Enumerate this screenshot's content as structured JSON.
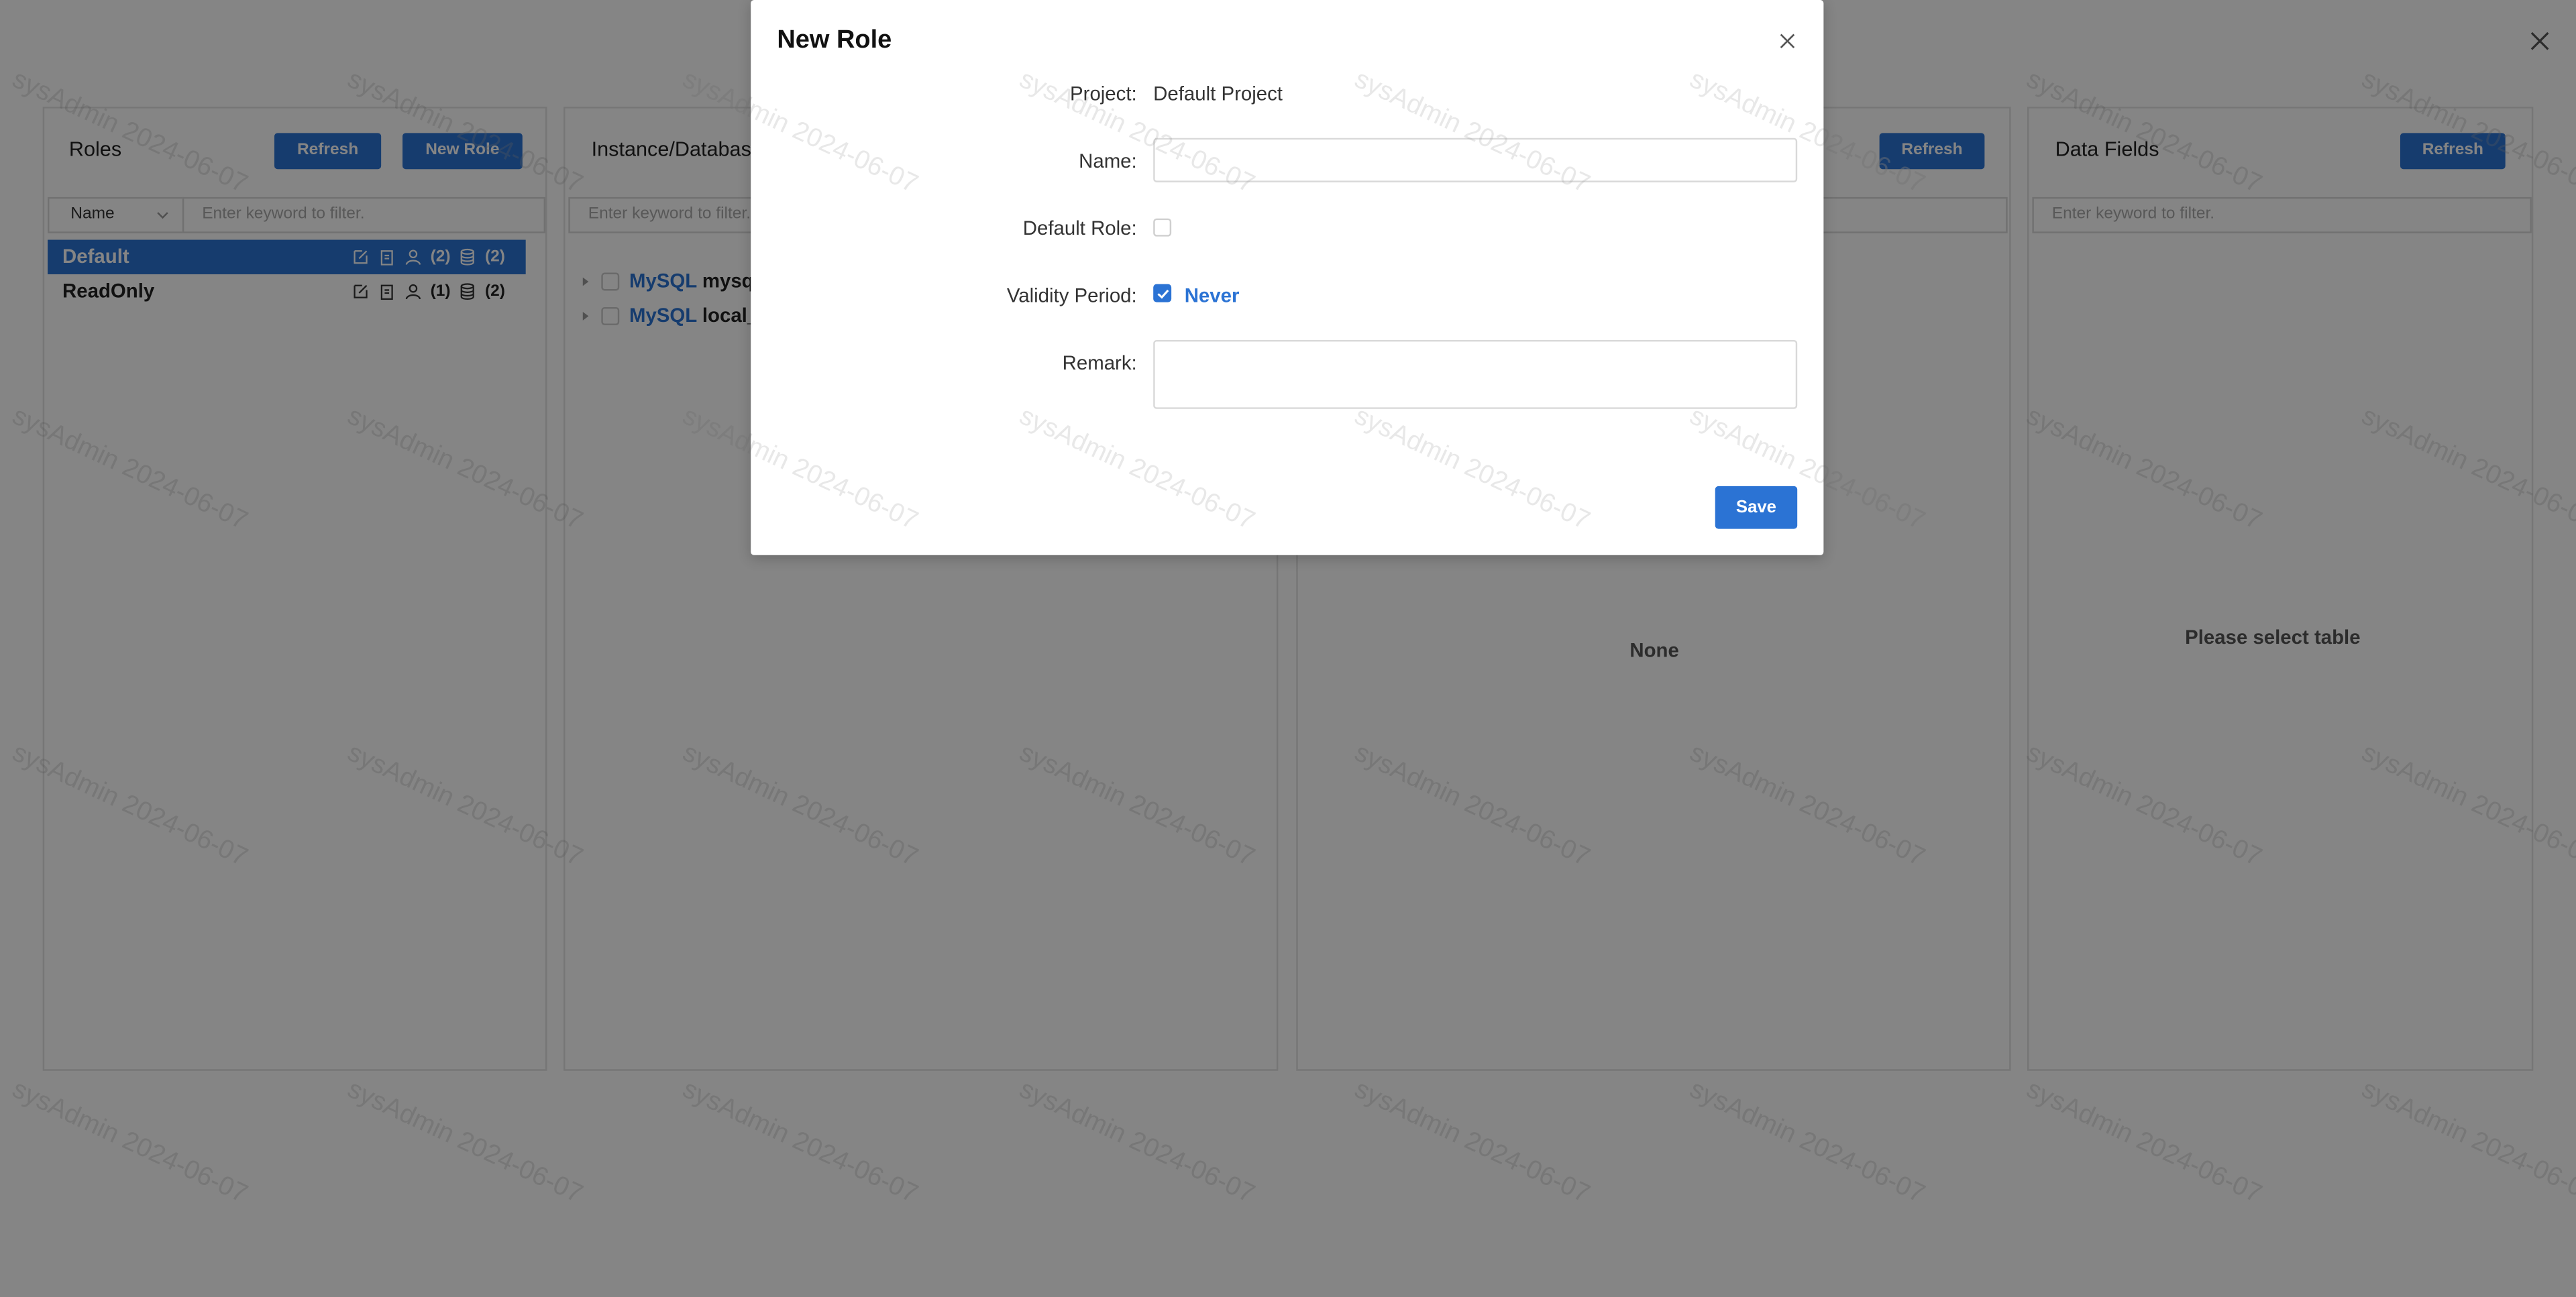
{
  "watermark": {
    "text": "sysAdmin 2024-06-07"
  },
  "roles_panel": {
    "title": "Roles",
    "refresh_label": "Refresh",
    "new_role_label": "New Role",
    "filter_field": "Name",
    "filter_placeholder": "Enter keyword to filter.",
    "roles": [
      {
        "name": "Default",
        "users": "(2)",
        "databases": "(2)",
        "selected": true
      },
      {
        "name": "ReadOnly",
        "users": "(1)",
        "databases": "(2)",
        "selected": false
      }
    ]
  },
  "instance_panel": {
    "title": "Instance/Database",
    "filter_placeholder": "Enter keyword to filter.",
    "items": [
      {
        "type": "MySQL",
        "name": "mysq"
      },
      {
        "type": "MySQL",
        "name": "local_"
      }
    ]
  },
  "tables_panel": {
    "refresh_label": "Refresh",
    "empty_text": "None"
  },
  "fields_panel": {
    "title": "Data Fields",
    "refresh_label": "Refresh",
    "filter_placeholder": "Enter keyword to filter.",
    "empty_text": "Please select table"
  },
  "modal": {
    "title": "New Role",
    "project_label": "Project:",
    "project_value": "Default Project",
    "name_label": "Name:",
    "name_value": "",
    "default_role_label": "Default Role:",
    "default_role_checked": false,
    "validity_label": "Validity Period:",
    "validity_checked": true,
    "validity_value": "Never",
    "remark_label": "Remark:",
    "remark_value": "",
    "save_label": "Save"
  },
  "colors": {
    "accent": "#2b73d4",
    "overlay": "rgba(0,0,0,0.48)"
  }
}
